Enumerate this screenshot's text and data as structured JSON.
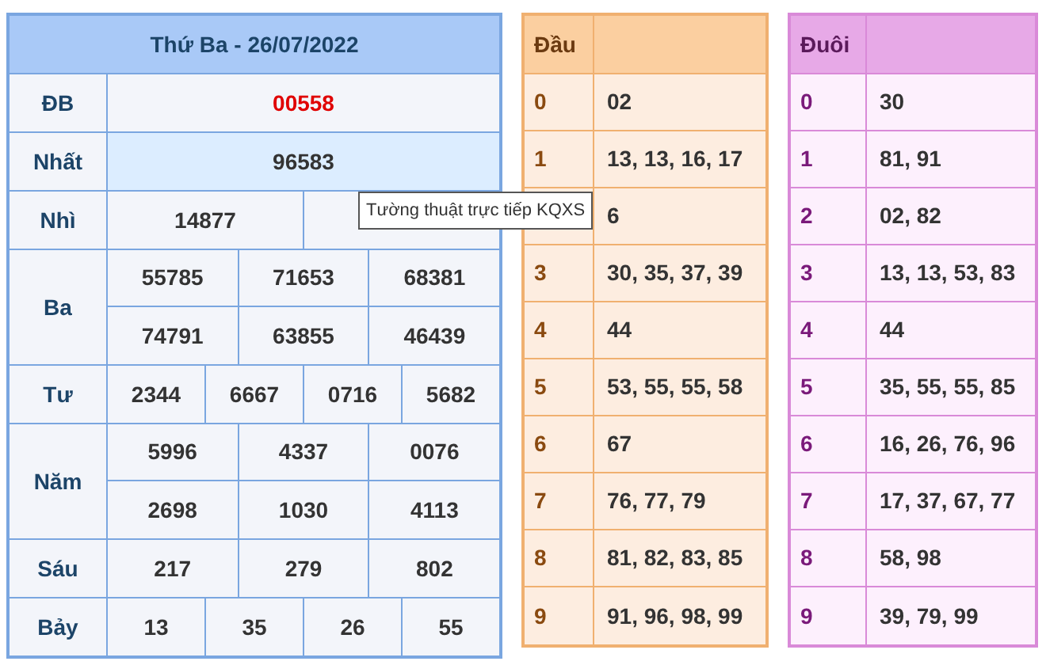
{
  "results": {
    "title": "Thứ Ba - 26/07/2022",
    "prizes": [
      {
        "label": "ĐB",
        "kind": "special",
        "lines": [
          [
            "00558"
          ]
        ]
      },
      {
        "label": "Nhất",
        "kind": "first",
        "lines": [
          [
            "96583"
          ]
        ]
      },
      {
        "label": "Nhì",
        "kind": "normal",
        "lines": [
          [
            "14877",
            {
              "covered": true
            }
          ]
        ]
      },
      {
        "label": "Ba",
        "kind": "normal",
        "lines": [
          [
            "55785",
            "71653",
            "68381"
          ],
          [
            "74791",
            "63855",
            "46439"
          ]
        ]
      },
      {
        "label": "Tư",
        "kind": "normal",
        "lines": [
          [
            "2344",
            "6667",
            "0716",
            "5682"
          ]
        ]
      },
      {
        "label": "Năm",
        "kind": "normal",
        "lines": [
          [
            "5996",
            "4337",
            "0076"
          ],
          [
            "2698",
            "1030",
            "4113"
          ]
        ]
      },
      {
        "label": "Sáu",
        "kind": "normal",
        "lines": [
          [
            "217",
            "279",
            "802"
          ]
        ]
      },
      {
        "label": "Bảy",
        "kind": "normal",
        "lines": [
          [
            "13",
            "35",
            "26",
            "55"
          ]
        ]
      }
    ]
  },
  "heads": {
    "title": "Đầu",
    "rows": [
      {
        "digit": "0",
        "values": "02"
      },
      {
        "digit": "1",
        "values": "13, 13, 16, 17"
      },
      {
        "values": "6"
      },
      {
        "digit": "3",
        "values": "30, 35, 37, 39"
      },
      {
        "digit": "4",
        "values": "44"
      },
      {
        "digit": "5",
        "values": "53, 55, 55, 58"
      },
      {
        "digit": "6",
        "values": "67"
      },
      {
        "digit": "7",
        "values": "76, 77, 79"
      },
      {
        "digit": "8",
        "values": "81, 82, 83, 85"
      },
      {
        "digit": "9",
        "values": "91, 96, 98, 99"
      }
    ]
  },
  "tails": {
    "title": "Đuôi",
    "rows": [
      {
        "digit": "0",
        "values": "30"
      },
      {
        "digit": "1",
        "values": "81, 91"
      },
      {
        "digit": "2",
        "values": "02, 82"
      },
      {
        "digit": "3",
        "values": "13, 13, 53, 83"
      },
      {
        "digit": "4",
        "values": "44"
      },
      {
        "digit": "5",
        "values": "35, 55, 55, 85"
      },
      {
        "digit": "6",
        "values": "16, 26, 76, 96"
      },
      {
        "digit": "7",
        "values": "17, 37, 67, 77"
      },
      {
        "digit": "8",
        "values": "58, 98"
      },
      {
        "digit": "9",
        "values": "39, 79, 99"
      }
    ]
  },
  "tooltip": "Tường thuật trực tiếp KQXS"
}
